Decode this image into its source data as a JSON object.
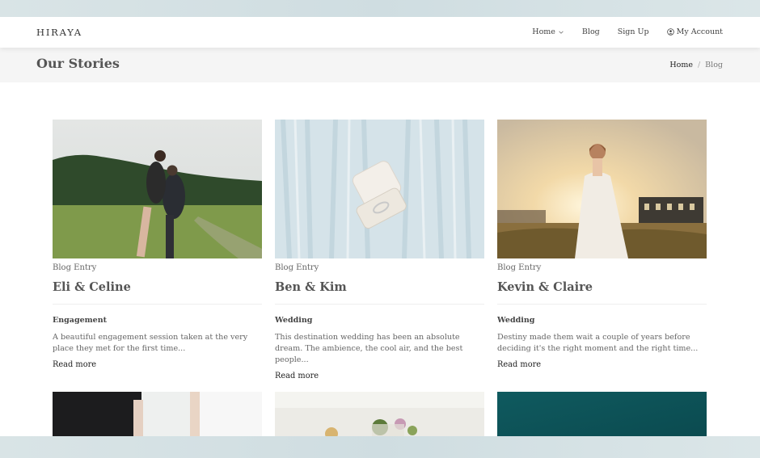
{
  "nav": {
    "brand": "HIRAYA",
    "items": [
      {
        "label": "Home",
        "has_dropdown": true
      },
      {
        "label": "Blog"
      },
      {
        "label": "Sign Up"
      },
      {
        "label": "My Account",
        "icon": "user-circle-icon"
      }
    ]
  },
  "header": {
    "title": "Our Stories",
    "breadcrumb": {
      "home": "Home",
      "separator": "/",
      "current": "Blog"
    }
  },
  "cards": [
    {
      "type": "Blog Entry",
      "title": "Eli & Celine",
      "category": "Engagement",
      "description": "A beautiful engagement session taken at the very place they met for the first time...",
      "link": "Read more"
    },
    {
      "type": "Blog Entry",
      "title": "Ben & Kim",
      "category": "Wedding",
      "description": "This destination wedding has been an absolute dream. The ambience, the cool air, and the best people...",
      "link": "Read more"
    },
    {
      "type": "Blog Entry",
      "title": "Kevin & Claire",
      "category": "Wedding",
      "description": "Destiny made them wait a couple of years before deciding it's the right moment and the right time...",
      "link": "Read more"
    }
  ]
}
